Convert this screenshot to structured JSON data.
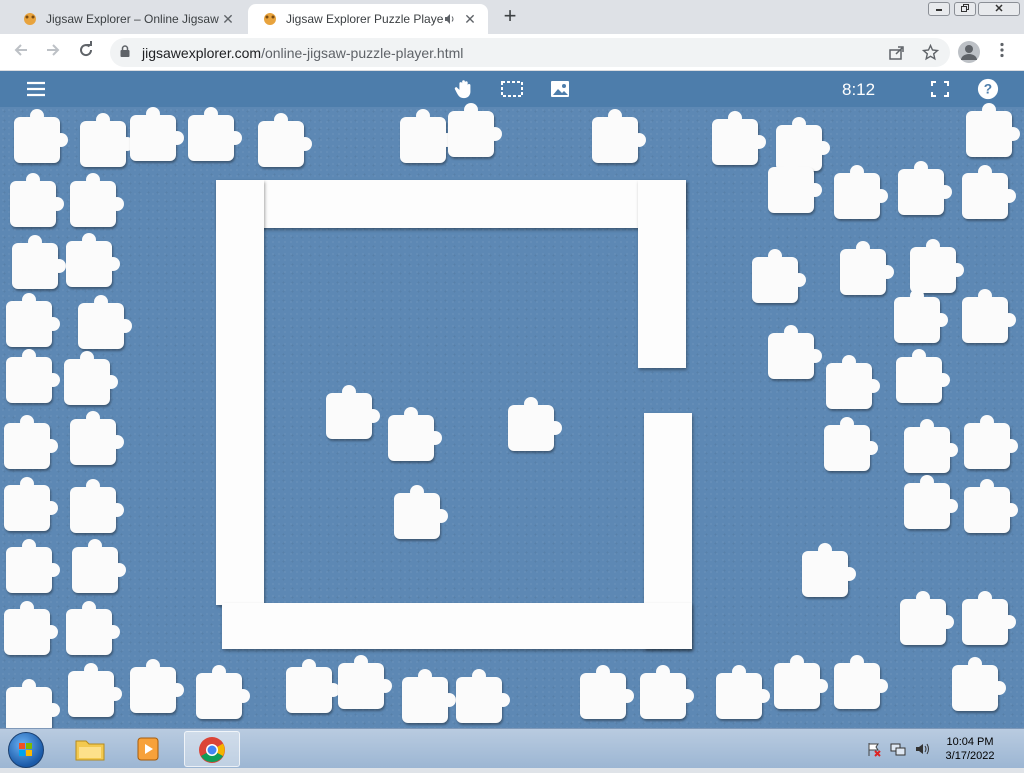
{
  "browser": {
    "tabs": [
      {
        "title": "Jigsaw Explorer – Online Jigsaw P",
        "active": false
      },
      {
        "title": "Jigsaw Explorer Puzzle Player",
        "active": true
      }
    ],
    "close_glyph": "✕",
    "new_tab_glyph": "+",
    "url_domain": "jigsawexplorer.com",
    "url_path": "/online-jigsaw-puzzle-player.html"
  },
  "app": {
    "timer": "8:12",
    "icons": [
      "menu-icon",
      "hand-icon",
      "selection-icon",
      "image-icon",
      "fullscreen-icon",
      "help-icon"
    ],
    "help_glyph": "?"
  },
  "taskbar": {
    "time": "10:04 PM",
    "date": "3/17/2022"
  },
  "colors": {
    "board": "#5d88b4",
    "header": "#4d7dab",
    "piece": "#fbfbfb"
  }
}
